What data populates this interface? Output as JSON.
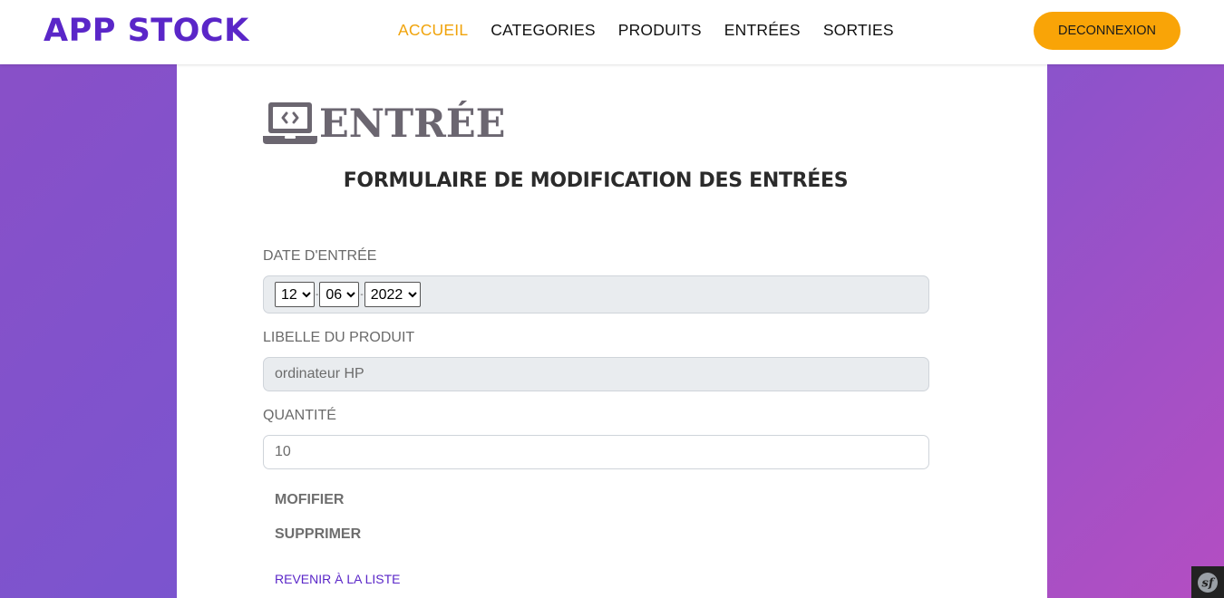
{
  "header": {
    "logo": "APP STOCK",
    "nav": [
      {
        "label": "ACCUEIL",
        "active": true
      },
      {
        "label": "CATEGORIES",
        "active": false
      },
      {
        "label": "PRODUITS",
        "active": false
      },
      {
        "label": "ENTRÉES",
        "active": false
      },
      {
        "label": "SORTIES",
        "active": false
      }
    ],
    "logout_label": "DECONNEXION"
  },
  "page": {
    "title_icon": "laptop-code-icon",
    "title": "ENTRÉE",
    "form_heading": "FORMULAIRE DE MODIFICATION DES ENTRÉES"
  },
  "form": {
    "date_label": "DATE D'ENTRÉE",
    "date": {
      "day": "12",
      "month": "06",
      "year": "2022"
    },
    "product_label": "LIBELLE DU PRODUIT",
    "product_value": "ordinateur HP",
    "quantity_label": "QUANTITÉ",
    "quantity_value": "10",
    "modify_label": "MOFIFIER",
    "delete_label": "SUPPRIMER",
    "back_label": "REVENIR À LA LISTE"
  },
  "colors": {
    "brand": "#5a26c8",
    "nav_active": "#f0a30a",
    "logout_button": "#f9a407"
  }
}
